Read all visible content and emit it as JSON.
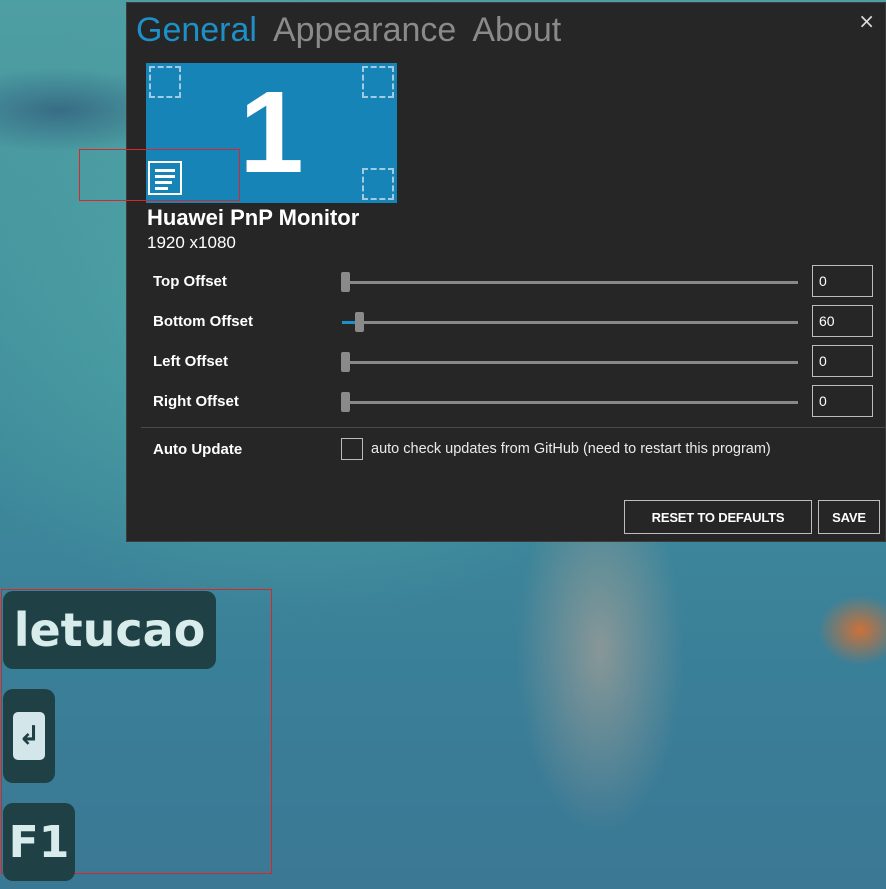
{
  "tabs": [
    {
      "label": "General",
      "active": true
    },
    {
      "label": "Appearance",
      "active": false
    },
    {
      "label": "About",
      "active": false
    }
  ],
  "close_icon": "×",
  "monitor": {
    "number": "1",
    "name": "Huawei PnP Monitor",
    "resolution": "1920 x1080"
  },
  "offsets": [
    {
      "label": "Top Offset",
      "value": "0",
      "slider_fraction": 0
    },
    {
      "label": "Bottom Offset",
      "value": "60",
      "slider_fraction": 0.06
    },
    {
      "label": "Left Offset",
      "value": "0",
      "slider_fraction": 0
    },
    {
      "label": "Right Offset",
      "value": "0",
      "slider_fraction": 0
    }
  ],
  "auto_update": {
    "label": "Auto Update",
    "checkbox_text": "auto check updates from GitHub (need to restart this program)",
    "checked": false
  },
  "buttons": {
    "reset": "RESET TO DEFAULTS",
    "save": "SAVE"
  },
  "keys": {
    "text_key": "letucao",
    "enter_glyph": "↲",
    "function_key": "F1"
  },
  "colors": {
    "accent": "#1e90c8",
    "window_bg": "#262626",
    "preview_bg": "#1784b8",
    "highlight_border": "#d9262b",
    "key_bg": "#1f4145"
  }
}
